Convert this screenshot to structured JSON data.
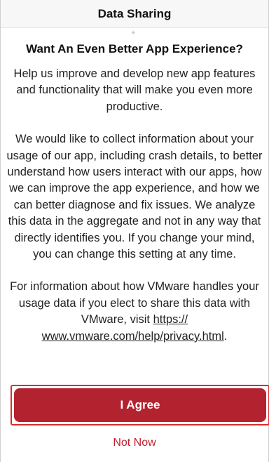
{
  "header": {
    "title": "Data Sharing"
  },
  "decor": {
    "sparkle_icon": "sparkle-icon"
  },
  "content": {
    "heading": "Want An Even Better App Experience?",
    "para1": "Help us improve and develop new app features and functionality that will make you even more productive.",
    "para2": "We would like to collect information about your usage of our app, including crash details, to better understand how users interact with our apps, how we can improve the app experience, and how we can better diagnose and fix issues. We analyze this data in the aggregate and not in any way that directly identifies you. If you change your mind, you can change this setting at any time.",
    "para3_prefix": "For information about how VMware handles your usage data if you elect to share this data with VMware, visit ",
    "privacy_link": "https://​www.vmware.com/help/privacy.html",
    "para3_suffix": "."
  },
  "actions": {
    "agree_label": "I Agree",
    "not_now_label": "Not Now"
  },
  "colors": {
    "accent": "#b3222f",
    "highlight_border": "#d92d2d",
    "not_now": "#c0202d"
  }
}
